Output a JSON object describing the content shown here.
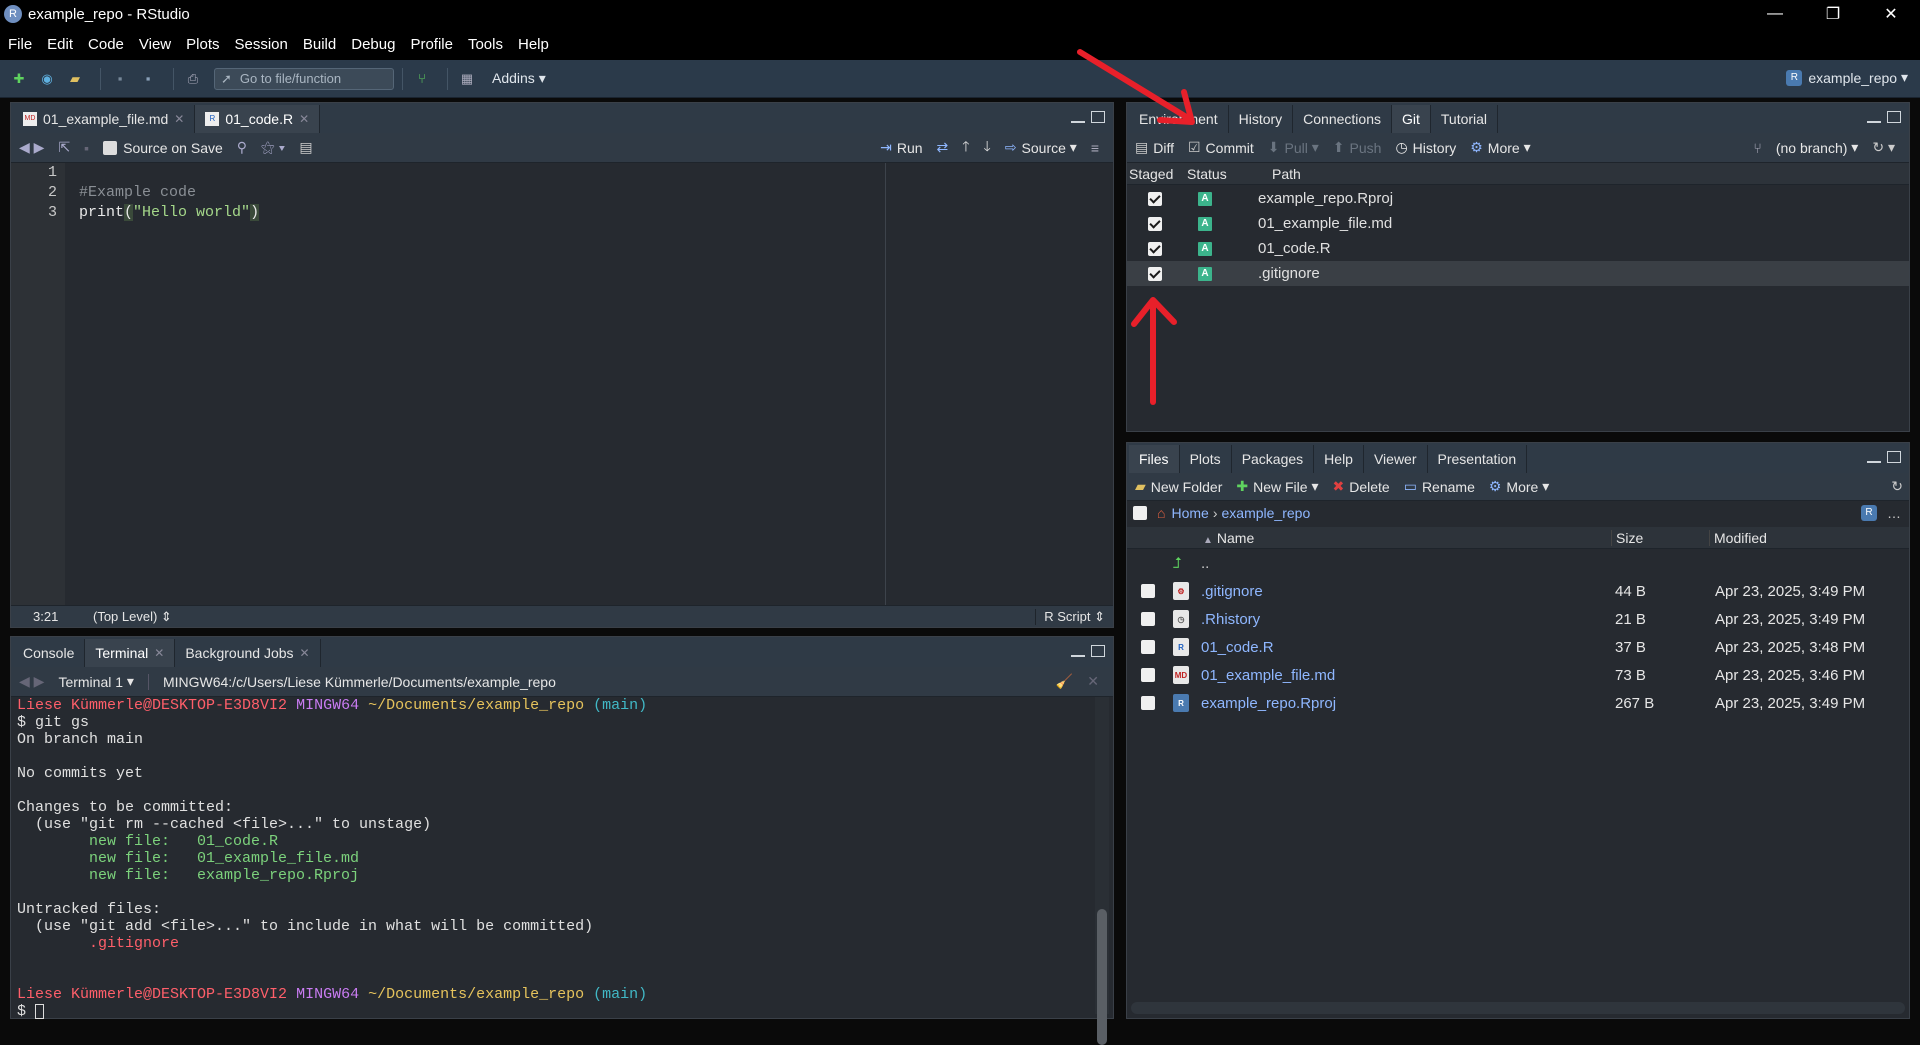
{
  "window": {
    "title": "example_repo - RStudio",
    "min": "—",
    "max": "❐",
    "close": "✕"
  },
  "menu": [
    "File",
    "Edit",
    "Code",
    "View",
    "Plots",
    "Session",
    "Build",
    "Debug",
    "Profile",
    "Tools",
    "Help"
  ],
  "toolbar": {
    "goto_placeholder": "Go to file/function",
    "addins": "Addins",
    "project": "example_repo"
  },
  "editor": {
    "tabs": [
      "01_example_file.md",
      "01_code.R"
    ],
    "active_tab": "01_code.R",
    "source_on_save": "Source on Save",
    "run": "Run",
    "source": "Source",
    "line_numbers": [
      "1",
      "2",
      "3"
    ],
    "lines": [
      "",
      "#Example code",
      "print(\"Hello world\")"
    ],
    "cursor": "3:21",
    "scope": "(Top Level)",
    "filetype": "R Script"
  },
  "console": {
    "tabs": [
      "Console",
      "Terminal",
      "Background Jobs"
    ],
    "active_tab": "Terminal",
    "terminal_name": "Terminal 1",
    "path": "MINGW64:/c/Users/Liese Kümmerle/Documents/example_repo",
    "prompt_user": "Liese Kümmerle@DESKTOP-E3D8VI2",
    "prompt_sys": "MINGW64",
    "prompt_dir": "~/Documents/example_repo",
    "prompt_branch": "(main)",
    "lines": {
      "cmd": "$ git gs",
      "l1": "On branch main",
      "l2": "No commits yet",
      "l3": "Changes to be committed:",
      "l4": "  (use \"git rm --cached <file>...\" to unstage)",
      "n1": "        new file:   01_code.R",
      "n2": "        new file:   01_example_file.md",
      "n3": "        new file:   example_repo.Rproj",
      "l5": "Untracked files:",
      "l6": "  (use \"git add <file>...\" to include in what will be committed)",
      "u1": "        .gitignore",
      "last": "$ "
    }
  },
  "git_pane": {
    "tabs": [
      "Environment",
      "History",
      "Connections",
      "Git",
      "Tutorial"
    ],
    "active_tab": "Git",
    "toolbar": {
      "diff": "Diff",
      "commit": "Commit",
      "pull": "Pull",
      "push": "Push",
      "history": "History",
      "more": "More",
      "branch": "(no branch)"
    },
    "headers": {
      "staged": "Staged",
      "status": "Status",
      "path": "Path"
    },
    "files": [
      {
        "path": "example_repo.Rproj",
        "status": "A"
      },
      {
        "path": "01_example_file.md",
        "status": "A"
      },
      {
        "path": "01_code.R",
        "status": "A"
      },
      {
        "path": ".gitignore",
        "status": "A"
      }
    ]
  },
  "files_pane": {
    "tabs": [
      "Files",
      "Plots",
      "Packages",
      "Help",
      "Viewer",
      "Presentation"
    ],
    "active_tab": "Files",
    "toolbar": {
      "new_folder": "New Folder",
      "new_file": "New File",
      "delete": "Delete",
      "rename": "Rename",
      "more": "More"
    },
    "breadcrumb": {
      "home": "Home",
      "sep": "›",
      "folder": "example_repo"
    },
    "headers": {
      "name": "Name",
      "size": "Size",
      "modified": "Modified"
    },
    "up": "..",
    "files": [
      {
        "name": ".gitignore",
        "size": "44 B",
        "modified": "Apr 23, 2025, 3:49 PM"
      },
      {
        "name": ".Rhistory",
        "size": "21 B",
        "modified": "Apr 23, 2025, 3:49 PM"
      },
      {
        "name": "01_code.R",
        "size": "37 B",
        "modified": "Apr 23, 2025, 3:48 PM"
      },
      {
        "name": "01_example_file.md",
        "size": "73 B",
        "modified": "Apr 23, 2025, 3:46 PM"
      },
      {
        "name": "example_repo.Rproj",
        "size": "267 B",
        "modified": "Apr 23, 2025, 3:49 PM"
      }
    ]
  },
  "colors": {
    "accent_red": "#e8202a",
    "prompt_red": "#ff5f6a",
    "prompt_purple": "#c97cf2",
    "prompt_yellow": "#e6c35c",
    "prompt_cyan": "#41b8c6",
    "new_file_green": "#7cd27c"
  }
}
